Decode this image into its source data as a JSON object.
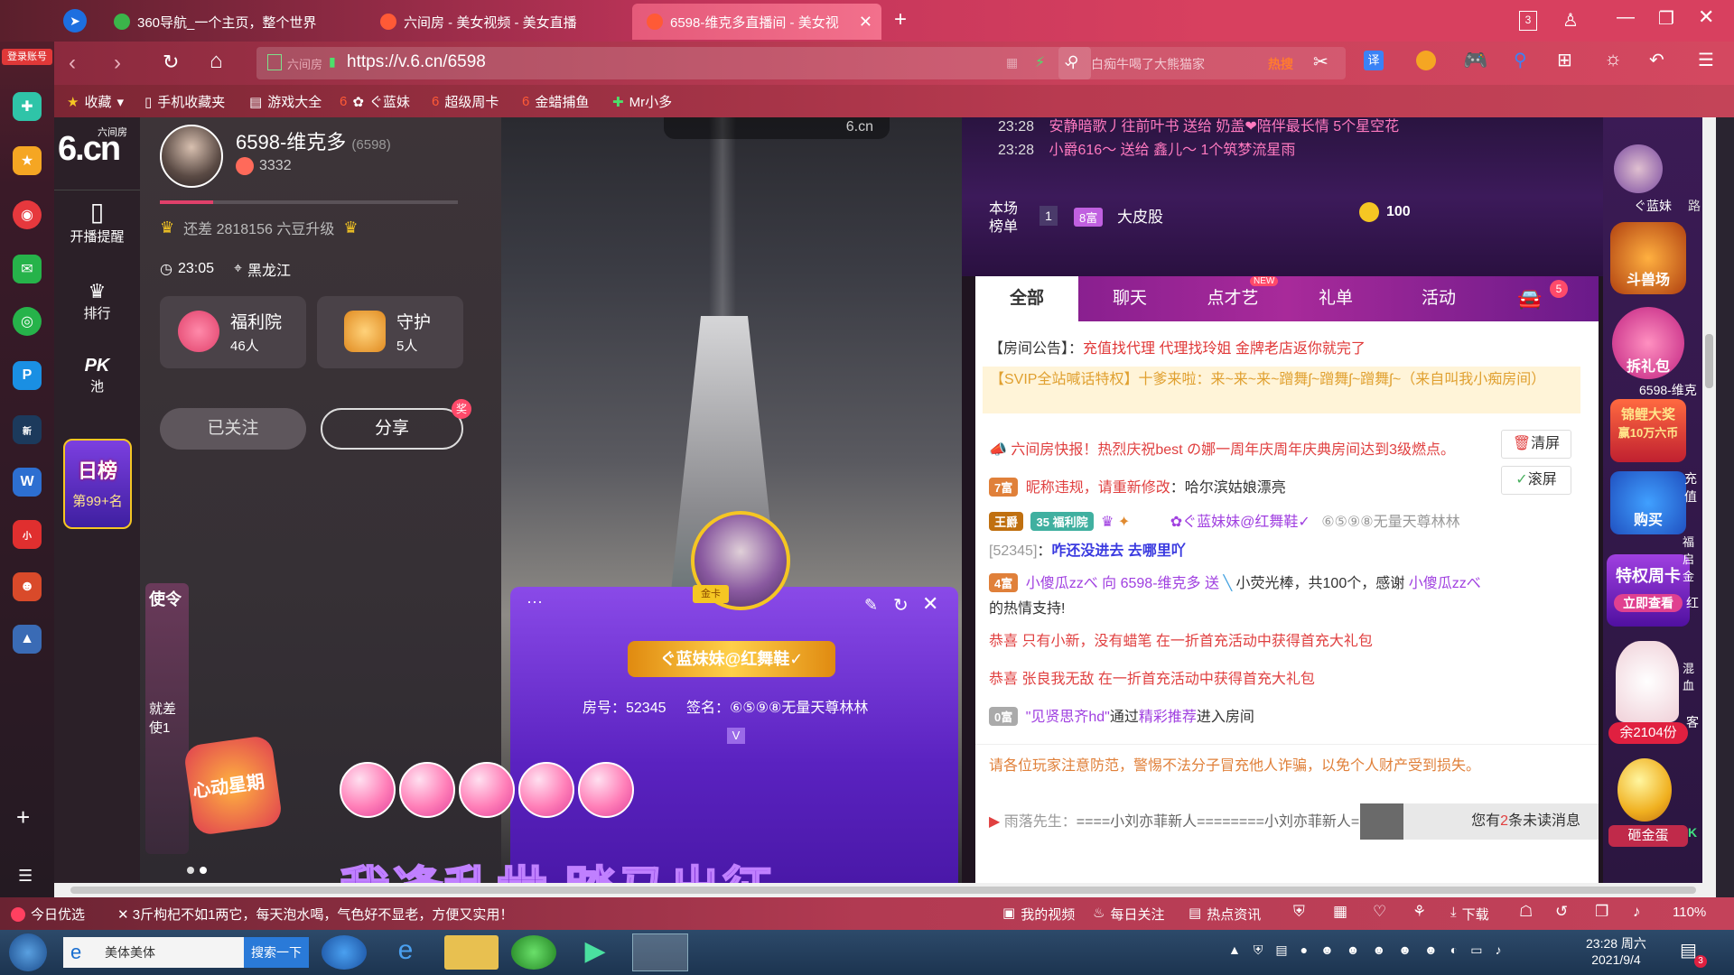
{
  "browser": {
    "login_label": "登录账号",
    "tabs": [
      {
        "title": "360导航_一个主页，整个世界"
      },
      {
        "title": "六间房 - 美女视频 - 美女直播"
      },
      {
        "title": "6598-维克多直播间 - 美女视"
      }
    ],
    "tab_count": "3",
    "address": "https://v.6.cn/6598",
    "address_tag": "六间房",
    "search_placeholder": "白痴牛喝了大熊猫家",
    "search_hot": "热搜",
    "bookmarks": [
      {
        "label": "收藏"
      },
      {
        "label": "手机收藏夹"
      },
      {
        "label": "游戏大全"
      },
      {
        "label": "ぐ蓝妹"
      },
      {
        "label": "超级周卡"
      },
      {
        "label": "金蜡捕鱼"
      },
      {
        "label": "Mr小多"
      }
    ],
    "translate_label": "译"
  },
  "site_nav": {
    "logo_sub": "六间房",
    "logo_main": "6.cn",
    "items": [
      {
        "label": "开播提醒"
      },
      {
        "label": "排行"
      },
      {
        "label": "池"
      }
    ],
    "pk_label": "PK",
    "daily_rank_title": "日榜",
    "daily_rank_value": "第99+名"
  },
  "anchor": {
    "name": "6598-维克多",
    "room_id": "(6598)",
    "fans": "3332",
    "level_progress": 0.18,
    "upgrade_text": "还差 2818156 六豆升级",
    "time": "23:05",
    "location": "黑龙江",
    "welfare_title": "福利院",
    "welfare_count": "46人",
    "guard_title": "守护",
    "guard_count": "5人",
    "follow_label": "已关注",
    "share_label": "分享",
    "share_badge": "奖",
    "heart_star_label": "心动星期",
    "envoy_label": "使令",
    "envoy_sub": "就差使1"
  },
  "video": {
    "top_label": "6.cn",
    "caption": "我逢乱世 踏马出征",
    "card_name": "ぐ蓝妹妹@红舞鞋✓",
    "card_room": "房号：52345",
    "card_sign": "签名：⑥⑤⑨⑧无量天尊林林",
    "card_v": "V",
    "card_badge": "金卡"
  },
  "chat": {
    "top_messages": [
      {
        "time": "23:28",
        "text": "安静暗歌丿往前叶书 送给 奶盖❤陪伴最长情 5个星空花"
      },
      {
        "time": "23:28",
        "text": "小爵616～ 送给 鑫儿～ 1个筑梦流星雨"
      }
    ],
    "rank_label": "本场榜单",
    "rank_pos": "1",
    "rank_badge": "8富",
    "rank_user": "大皮股",
    "rank_points": "100",
    "tabs": [
      {
        "label": "全部",
        "active": true
      },
      {
        "label": "聊天"
      },
      {
        "label": "点才艺",
        "badge": "NEW"
      },
      {
        "label": "礼单"
      },
      {
        "label": "活动"
      }
    ],
    "car_badge": "5",
    "announcement_label": "【房间公告】：",
    "announcement": "充值找代理 代理找玲姐 金牌老店返你就完了",
    "svip_text": "【SVIP全站喊话特权】十爹来啦：来~来~来~蹭舞ʃ~蹭舞ʃ~蹭舞ʃ~（来自叫我小痴房间）",
    "news_text": "六间房快报！热烈庆祝best の娜一周年庆周年庆典房间达到3级燃点。",
    "clear_label": "清屏",
    "scroll_label": "滚屏",
    "nick_warning_badge": "7富",
    "nick_warning": "昵称违规，请重新修改",
    "nick_warning_user": "：哈尔滨姑娘漂亮",
    "vip_badge": "王爵",
    "welfare_badge": "福利院",
    "welfare_level": "35",
    "vip_user": "✿ぐ蓝妹妹@红舞鞋✓",
    "vip_target": "⑥⑤⑨⑧无量天尊林林",
    "vip_room": "[52345]",
    "vip_msg": "咋还没进去 去哪里吖",
    "gift_badge": "4富",
    "gift_user": "小傻瓜zzべ",
    "gift_text_1": "向 6598-维克多 送",
    "gift_item": "小荧光棒，共100个，感谢",
    "gift_text_2": "小傻瓜zzべ",
    "gift_text_3": "的热情支持!",
    "congrats_1": "恭喜 只有小新，没有蜡笔 在一折首充活动中获得首充大礼包",
    "congrats_2": "恭喜 张良我无敌 在一折首充活动中获得首充大礼包",
    "enter_badge": "0富",
    "enter_user": "\"见贤思齐hd\"",
    "enter_via": "通过",
    "enter_link": "精彩推荐",
    "enter_text": "进入房间",
    "warning": "请各位玩家注意防范，警惕不法分子冒充他人诈骗，以免个人财产受到损失。",
    "bottom_msg_user": "雨落先生：",
    "bottom_msg": "====小刘亦菲新人========小刘亦菲新人========小刘亦菲",
    "unread_prefix": "您有",
    "unread_count": "2",
    "unread_suffix": "条未读消息"
  },
  "right_rail": {
    "items": [
      {
        "label": "ぐ蓝妹"
      },
      {
        "label": "斗兽场"
      },
      {
        "label": "拆礼包"
      },
      {
        "label": "6598-维克多"
      },
      {
        "label": "锦鲤大奖"
      },
      {
        "label": "赢10万六币"
      },
      {
        "label": "购买"
      },
      {
        "label": "特权周卡"
      },
      {
        "label": "立即查看"
      },
      {
        "label": "余2104份"
      },
      {
        "label": "砸金蛋"
      }
    ],
    "side_text": [
      "路",
      "充值",
      "福启金",
      "红",
      "混血",
      "客",
      "K"
    ]
  },
  "statusbar": {
    "left": "今日优选",
    "ticker": "3斤枸杞不如1两它，每天泡水喝，气色好不显老，方便又实用！",
    "items": [
      {
        "label": "我的视频"
      },
      {
        "label": "每日关注"
      },
      {
        "label": "热点资讯"
      },
      {
        "label": "下载"
      }
    ],
    "zoom": "110%"
  },
  "taskbar": {
    "search_text": "美体美体",
    "search_button": "搜索一下",
    "time": "23:28 周六",
    "date": "2021/9/4",
    "notification_count": "3"
  }
}
